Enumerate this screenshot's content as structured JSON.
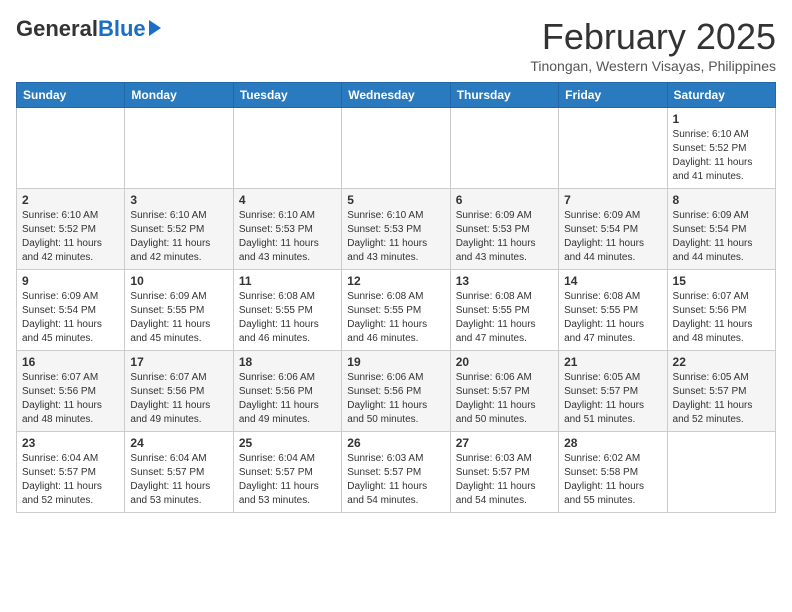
{
  "header": {
    "logo_general": "General",
    "logo_blue": "Blue",
    "month_title": "February 2025",
    "location": "Tinongan, Western Visayas, Philippines"
  },
  "days_of_week": [
    "Sunday",
    "Monday",
    "Tuesday",
    "Wednesday",
    "Thursday",
    "Friday",
    "Saturday"
  ],
  "weeks": [
    [
      {
        "day": "",
        "sunrise": "",
        "sunset": "",
        "daylight": ""
      },
      {
        "day": "",
        "sunrise": "",
        "sunset": "",
        "daylight": ""
      },
      {
        "day": "",
        "sunrise": "",
        "sunset": "",
        "daylight": ""
      },
      {
        "day": "",
        "sunrise": "",
        "sunset": "",
        "daylight": ""
      },
      {
        "day": "",
        "sunrise": "",
        "sunset": "",
        "daylight": ""
      },
      {
        "day": "",
        "sunrise": "",
        "sunset": "",
        "daylight": ""
      },
      {
        "day": "1",
        "sunrise": "Sunrise: 6:10 AM",
        "sunset": "Sunset: 5:52 PM",
        "daylight": "Daylight: 11 hours and 41 minutes."
      }
    ],
    [
      {
        "day": "2",
        "sunrise": "Sunrise: 6:10 AM",
        "sunset": "Sunset: 5:52 PM",
        "daylight": "Daylight: 11 hours and 42 minutes."
      },
      {
        "day": "3",
        "sunrise": "Sunrise: 6:10 AM",
        "sunset": "Sunset: 5:52 PM",
        "daylight": "Daylight: 11 hours and 42 minutes."
      },
      {
        "day": "4",
        "sunrise": "Sunrise: 6:10 AM",
        "sunset": "Sunset: 5:53 PM",
        "daylight": "Daylight: 11 hours and 43 minutes."
      },
      {
        "day": "5",
        "sunrise": "Sunrise: 6:10 AM",
        "sunset": "Sunset: 5:53 PM",
        "daylight": "Daylight: 11 hours and 43 minutes."
      },
      {
        "day": "6",
        "sunrise": "Sunrise: 6:09 AM",
        "sunset": "Sunset: 5:53 PM",
        "daylight": "Daylight: 11 hours and 43 minutes."
      },
      {
        "day": "7",
        "sunrise": "Sunrise: 6:09 AM",
        "sunset": "Sunset: 5:54 PM",
        "daylight": "Daylight: 11 hours and 44 minutes."
      },
      {
        "day": "8",
        "sunrise": "Sunrise: 6:09 AM",
        "sunset": "Sunset: 5:54 PM",
        "daylight": "Daylight: 11 hours and 44 minutes."
      }
    ],
    [
      {
        "day": "9",
        "sunrise": "Sunrise: 6:09 AM",
        "sunset": "Sunset: 5:54 PM",
        "daylight": "Daylight: 11 hours and 45 minutes."
      },
      {
        "day": "10",
        "sunrise": "Sunrise: 6:09 AM",
        "sunset": "Sunset: 5:55 PM",
        "daylight": "Daylight: 11 hours and 45 minutes."
      },
      {
        "day": "11",
        "sunrise": "Sunrise: 6:08 AM",
        "sunset": "Sunset: 5:55 PM",
        "daylight": "Daylight: 11 hours and 46 minutes."
      },
      {
        "day": "12",
        "sunrise": "Sunrise: 6:08 AM",
        "sunset": "Sunset: 5:55 PM",
        "daylight": "Daylight: 11 hours and 46 minutes."
      },
      {
        "day": "13",
        "sunrise": "Sunrise: 6:08 AM",
        "sunset": "Sunset: 5:55 PM",
        "daylight": "Daylight: 11 hours and 47 minutes."
      },
      {
        "day": "14",
        "sunrise": "Sunrise: 6:08 AM",
        "sunset": "Sunset: 5:55 PM",
        "daylight": "Daylight: 11 hours and 47 minutes."
      },
      {
        "day": "15",
        "sunrise": "Sunrise: 6:07 AM",
        "sunset": "Sunset: 5:56 PM",
        "daylight": "Daylight: 11 hours and 48 minutes."
      }
    ],
    [
      {
        "day": "16",
        "sunrise": "Sunrise: 6:07 AM",
        "sunset": "Sunset: 5:56 PM",
        "daylight": "Daylight: 11 hours and 48 minutes."
      },
      {
        "day": "17",
        "sunrise": "Sunrise: 6:07 AM",
        "sunset": "Sunset: 5:56 PM",
        "daylight": "Daylight: 11 hours and 49 minutes."
      },
      {
        "day": "18",
        "sunrise": "Sunrise: 6:06 AM",
        "sunset": "Sunset: 5:56 PM",
        "daylight": "Daylight: 11 hours and 49 minutes."
      },
      {
        "day": "19",
        "sunrise": "Sunrise: 6:06 AM",
        "sunset": "Sunset: 5:56 PM",
        "daylight": "Daylight: 11 hours and 50 minutes."
      },
      {
        "day": "20",
        "sunrise": "Sunrise: 6:06 AM",
        "sunset": "Sunset: 5:57 PM",
        "daylight": "Daylight: 11 hours and 50 minutes."
      },
      {
        "day": "21",
        "sunrise": "Sunrise: 6:05 AM",
        "sunset": "Sunset: 5:57 PM",
        "daylight": "Daylight: 11 hours and 51 minutes."
      },
      {
        "day": "22",
        "sunrise": "Sunrise: 6:05 AM",
        "sunset": "Sunset: 5:57 PM",
        "daylight": "Daylight: 11 hours and 52 minutes."
      }
    ],
    [
      {
        "day": "23",
        "sunrise": "Sunrise: 6:04 AM",
        "sunset": "Sunset: 5:57 PM",
        "daylight": "Daylight: 11 hours and 52 minutes."
      },
      {
        "day": "24",
        "sunrise": "Sunrise: 6:04 AM",
        "sunset": "Sunset: 5:57 PM",
        "daylight": "Daylight: 11 hours and 53 minutes."
      },
      {
        "day": "25",
        "sunrise": "Sunrise: 6:04 AM",
        "sunset": "Sunset: 5:57 PM",
        "daylight": "Daylight: 11 hours and 53 minutes."
      },
      {
        "day": "26",
        "sunrise": "Sunrise: 6:03 AM",
        "sunset": "Sunset: 5:57 PM",
        "daylight": "Daylight: 11 hours and 54 minutes."
      },
      {
        "day": "27",
        "sunrise": "Sunrise: 6:03 AM",
        "sunset": "Sunset: 5:57 PM",
        "daylight": "Daylight: 11 hours and 54 minutes."
      },
      {
        "day": "28",
        "sunrise": "Sunrise: 6:02 AM",
        "sunset": "Sunset: 5:58 PM",
        "daylight": "Daylight: 11 hours and 55 minutes."
      },
      {
        "day": "",
        "sunrise": "",
        "sunset": "",
        "daylight": ""
      }
    ]
  ]
}
